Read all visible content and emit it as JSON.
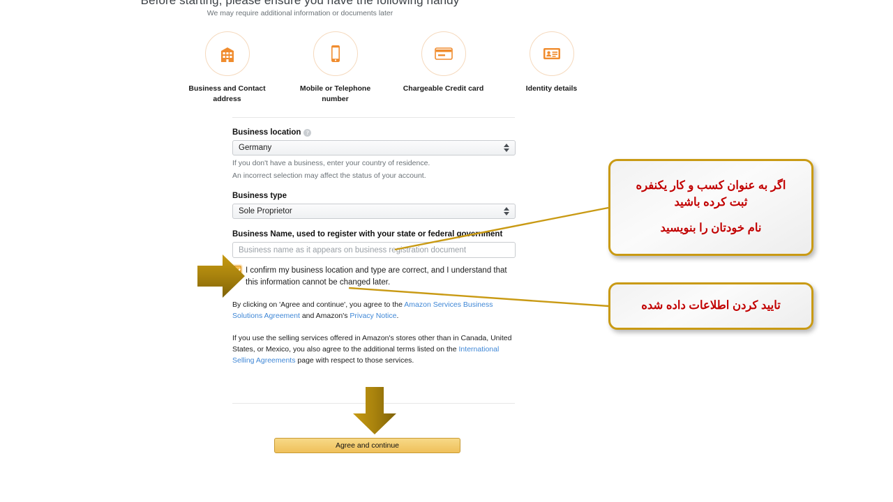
{
  "hero": {
    "title": "Before starting, please ensure you have the following handy",
    "subtitle": "We may require additional information or documents later"
  },
  "requirements": [
    {
      "icon": "building-icon",
      "label": "Business and Contact address"
    },
    {
      "icon": "mobile-phone-icon",
      "label": "Mobile or Telephone number"
    },
    {
      "icon": "credit-card-icon",
      "label": "Chargeable Credit card"
    },
    {
      "icon": "identity-card-icon",
      "label": "Identity details"
    }
  ],
  "form": {
    "business_location": {
      "label": "Business location",
      "value": "Germany",
      "hint_1": "If you don't have a business, enter your country of residence.",
      "hint_2": "An incorrect selection may affect the status of your account."
    },
    "business_type": {
      "label": "Business type",
      "value": "Sole Proprietor"
    },
    "business_name": {
      "label": "Business Name, used to register with your state or federal government",
      "placeholder": "Business name as it appears on business registration document",
      "value": ""
    },
    "confirm_checkbox": {
      "checked": true,
      "text": "I confirm my business location and type are correct, and I understand that this information cannot be changed later."
    }
  },
  "legal": {
    "para1_pre": "By clicking on 'Agree and continue', you agree to the ",
    "para1_link1": "Amazon Services Business Solutions Agreement",
    "para1_mid": " and Amazon's ",
    "para1_link2": "Privacy Notice",
    "para1_post": ".",
    "para2_pre": "If you use the selling services offered in Amazon's stores other than in Canada, United States, or Mexico, you also agree to the additional terms listed on the ",
    "para2_link": "International Selling Agreements",
    "para2_post": " page with respect to those services."
  },
  "submit_button": {
    "label": "Agree and continue"
  },
  "annotations": {
    "callout_1_line_1": "اگر به عنوان کسب و کار یکنفره\nثبت کرده باشید",
    "callout_1_line_2": "نام خودتان را بنویسید",
    "callout_2_line_1": "تایید کردن اطلاعات داده شده"
  },
  "colors": {
    "amazon_orange": "#f08c2e",
    "annotation_gold": "#c99a14",
    "annotation_red": "#c10000",
    "link_blue": "#3f87d6",
    "arrow_gold": "#a8820d"
  }
}
